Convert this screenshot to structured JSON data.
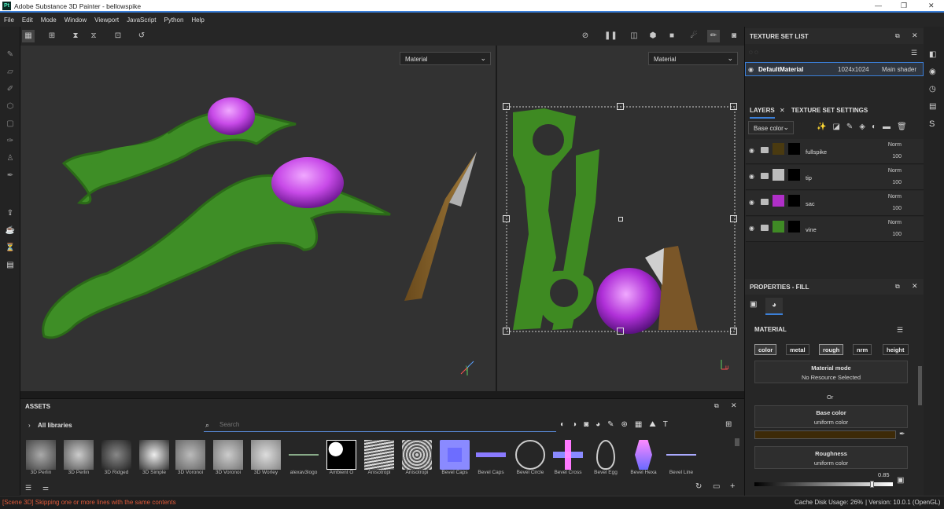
{
  "window": {
    "title": "Adobe Substance 3D Painter - bellowspike"
  },
  "menu": [
    "File",
    "Edit",
    "Mode",
    "Window",
    "Viewport",
    "JavaScript",
    "Python",
    "Help"
  ],
  "viewport3d": {
    "channel": "Material"
  },
  "viewport2d": {
    "channel": "Material"
  },
  "texture_set_list": {
    "title": "TEXTURE SET LIST",
    "item": {
      "name": "DefaultMaterial",
      "size": "1024x1024",
      "shader": "Main shader"
    }
  },
  "layers_panel": {
    "tab_layers": "LAYERS",
    "tab_settings": "TEXTURE SET SETTINGS",
    "channel": "Base color",
    "layers": [
      {
        "name": "fullspike",
        "blend": "Norm",
        "opacity": "100",
        "swatch": "#4a3a10"
      },
      {
        "name": "tip",
        "blend": "Norm",
        "opacity": "100",
        "swatch": "#bdbdbd"
      },
      {
        "name": "sac",
        "blend": "Norm",
        "opacity": "100",
        "swatch": "#b02fc8"
      },
      {
        "name": "vine",
        "blend": "Norm",
        "opacity": "100",
        "swatch": "#3f8a25"
      }
    ]
  },
  "properties": {
    "title": "PROPERTIES - FILL",
    "section": "MATERIAL",
    "chips": [
      "color",
      "metal",
      "rough",
      "nrm",
      "height"
    ],
    "material_mode": {
      "label": "Material mode",
      "value": "No Resource Selected"
    },
    "or": "Or",
    "base_color": {
      "label": "Base color",
      "value": "uniform color",
      "color": "#3d2a08"
    },
    "roughness": {
      "label": "Roughness",
      "value": "uniform color",
      "amount": "0.85",
      "fraction": 0.85
    }
  },
  "assets": {
    "title": "ASSETS",
    "library": "All libraries",
    "search_placeholder": "Search",
    "items": [
      "3D Perlin",
      "3D Perlin",
      "3D Ridged",
      "3D Simple",
      "3D Voronoi",
      "3D Voronoi",
      "3D Worley",
      "alexav3logo",
      "Ambient O",
      "Anisotropi",
      "Anisotropi",
      "Bevel Caps",
      "Bevel Caps",
      "Bevel Circle",
      "Bevel Cross",
      "Bevel Egg",
      "Bevel Hexa",
      "Bevel Line"
    ]
  },
  "status": {
    "message": "[Scene 3D] Skipping one or more lines with the same contents",
    "cache_label": "Cache Disk Usage:",
    "cache_value": "26%",
    "version": "| Version: 10.0.1 (OpenGL)"
  }
}
